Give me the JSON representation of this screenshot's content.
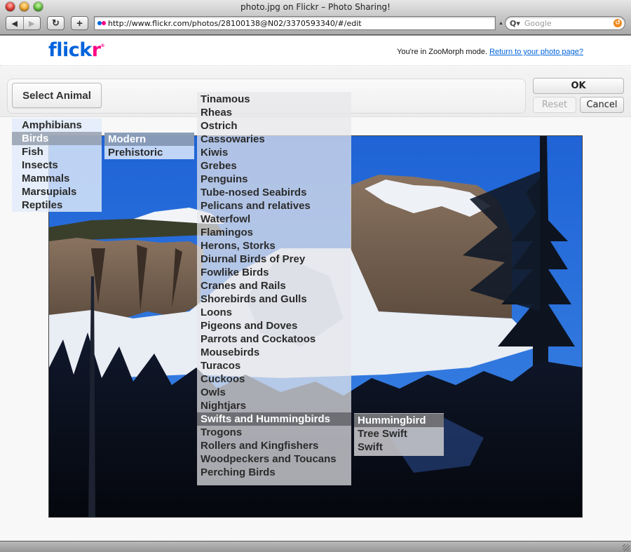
{
  "window": {
    "title": "photo.jpg on Flickr – Photo Sharing!"
  },
  "browser": {
    "back_glyph": "◀",
    "forward_glyph": "▶",
    "reload_glyph": "↻",
    "add_bookmark_glyph": "+",
    "url": "http://www.flickr.com/photos/28100138@N02/3370593340/#/edit",
    "search_placeholder": "Google",
    "search_icon_glyph": "Q▾",
    "snapback_glyph": "↺"
  },
  "header": {
    "logo_part1": "flick",
    "logo_part2": "r",
    "logo_reg": "®",
    "mode_text": "You're in ZooMorph mode. ",
    "return_link": "Return to your photo page?"
  },
  "toolbar": {
    "select_animal_label": "Select Animal",
    "ok_label": "OK",
    "reset_label": "Reset",
    "cancel_label": "Cancel"
  },
  "menus": {
    "categories": {
      "items": [
        "Amphibians",
        "Birds",
        "Fish",
        "Insects",
        "Mammals",
        "Marsupials",
        "Reptiles"
      ],
      "selected": "Birds"
    },
    "bird_eras": {
      "items": [
        "Modern",
        "Prehistoric"
      ],
      "selected": "Modern"
    },
    "bird_groups": {
      "items": [
        "Tinamous",
        "Rheas",
        "Ostrich",
        "Cassowaries",
        "Kiwis",
        "Grebes",
        "Penguins",
        "Tube-nosed Seabirds",
        "Pelicans and relatives",
        "Waterfowl",
        "Flamingos",
        "Herons, Storks",
        "Diurnal Birds of Prey",
        "Fowlike Birds",
        "Cranes and Rails",
        "Shorebirds and Gulls",
        "Loons",
        "Pigeons and Doves",
        "Parrots and Cockatoos",
        "Mousebirds",
        "Turacos",
        "Cuckoos",
        "Owls",
        "Nightjars",
        "Swifts and Hummingbirds",
        "Trogons",
        "Rollers and Kingfishers",
        "Woodpeckers and Toucans",
        "Perching Birds"
      ],
      "selected": "Swifts and Hummingbirds"
    },
    "species": {
      "items": [
        "Hummingbird",
        "Tree Swift",
        "Swift"
      ],
      "selected": "Hummingbird"
    }
  },
  "photo": {
    "description": "Snowy mountain cliffs with pine trees under blue sky",
    "sky_color": "#2a6fd8",
    "accent_blue": "#0063dc",
    "accent_pink": "#ff0084"
  }
}
